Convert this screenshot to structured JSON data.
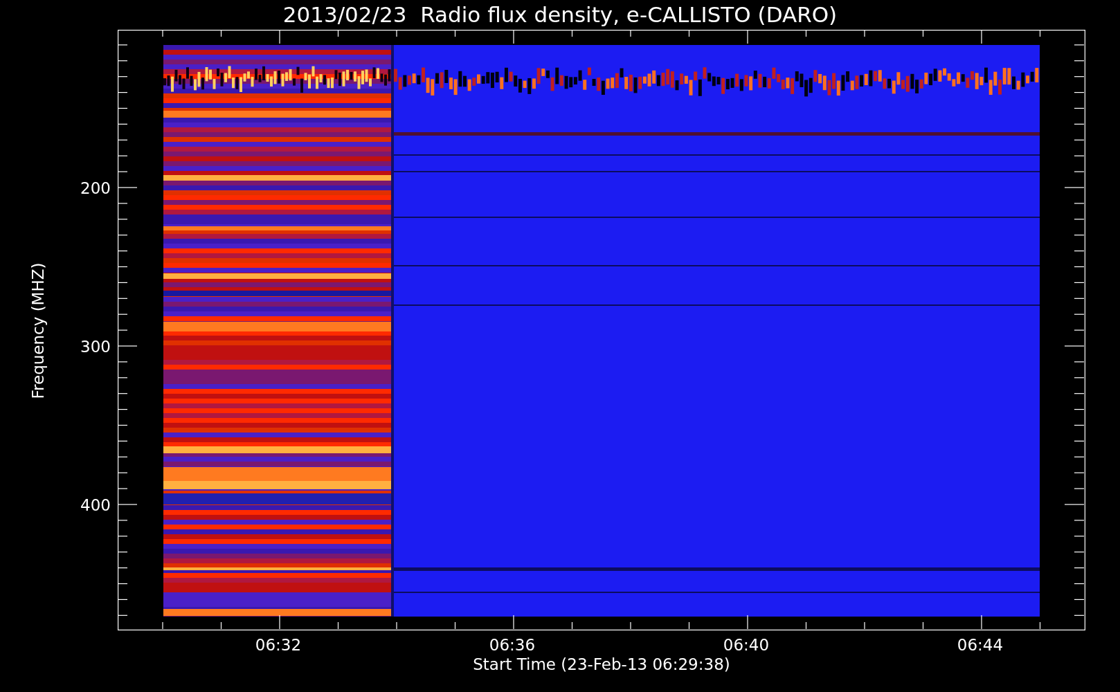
{
  "title": "2013/02/23  Radio flux density, e-CALLISTO (DARO)",
  "y_axis": {
    "label": "Frequency (MHZ)",
    "ticks": [
      "200",
      "300",
      "400"
    ]
  },
  "x_axis": {
    "label": "Start Time (23-Feb-13 06:29:38)",
    "ticks": [
      "06:32",
      "06:36",
      "06:40",
      "06:44"
    ]
  }
}
